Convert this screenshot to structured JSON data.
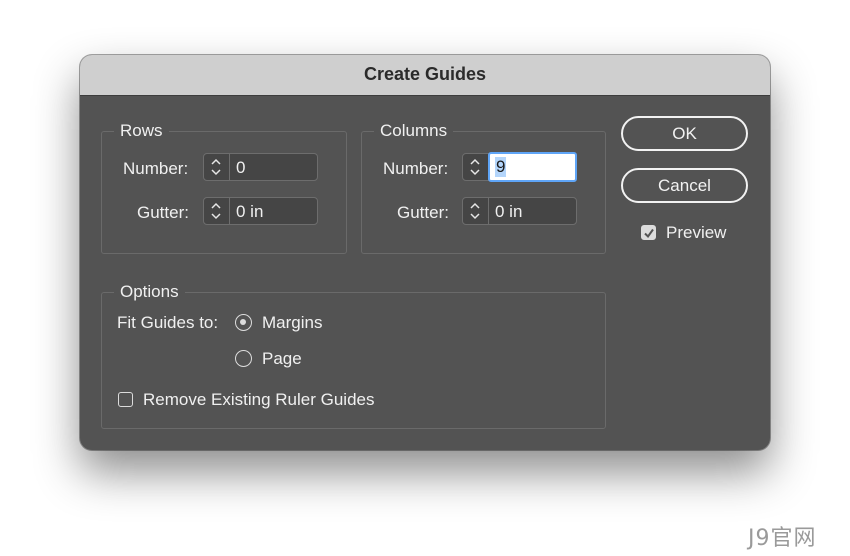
{
  "dialog": {
    "title": "Create Guides"
  },
  "rows": {
    "group_label": "Rows",
    "number_label": "Number:",
    "number_value": "0",
    "gutter_label": "Gutter:",
    "gutter_value": "0 in"
  },
  "columns": {
    "group_label": "Columns",
    "number_label": "Number:",
    "number_value": "9",
    "gutter_label": "Gutter:",
    "gutter_value": "0 in"
  },
  "buttons": {
    "ok": "OK",
    "cancel": "Cancel"
  },
  "preview": {
    "label": "Preview",
    "checked": true
  },
  "options": {
    "group_label": "Options",
    "fit_label": "Fit Guides to:",
    "fit_options": [
      "Margins",
      "Page"
    ],
    "fit_selected": "Margins",
    "remove_label": "Remove Existing Ruler Guides",
    "remove_checked": false
  },
  "watermark": "J9官网",
  "colors": {
    "dialog_bg": "#535353",
    "titlebar_bg": "#cfcfcf",
    "focus_ring": "#5fa5f7",
    "selection": "#b3d5fb"
  }
}
